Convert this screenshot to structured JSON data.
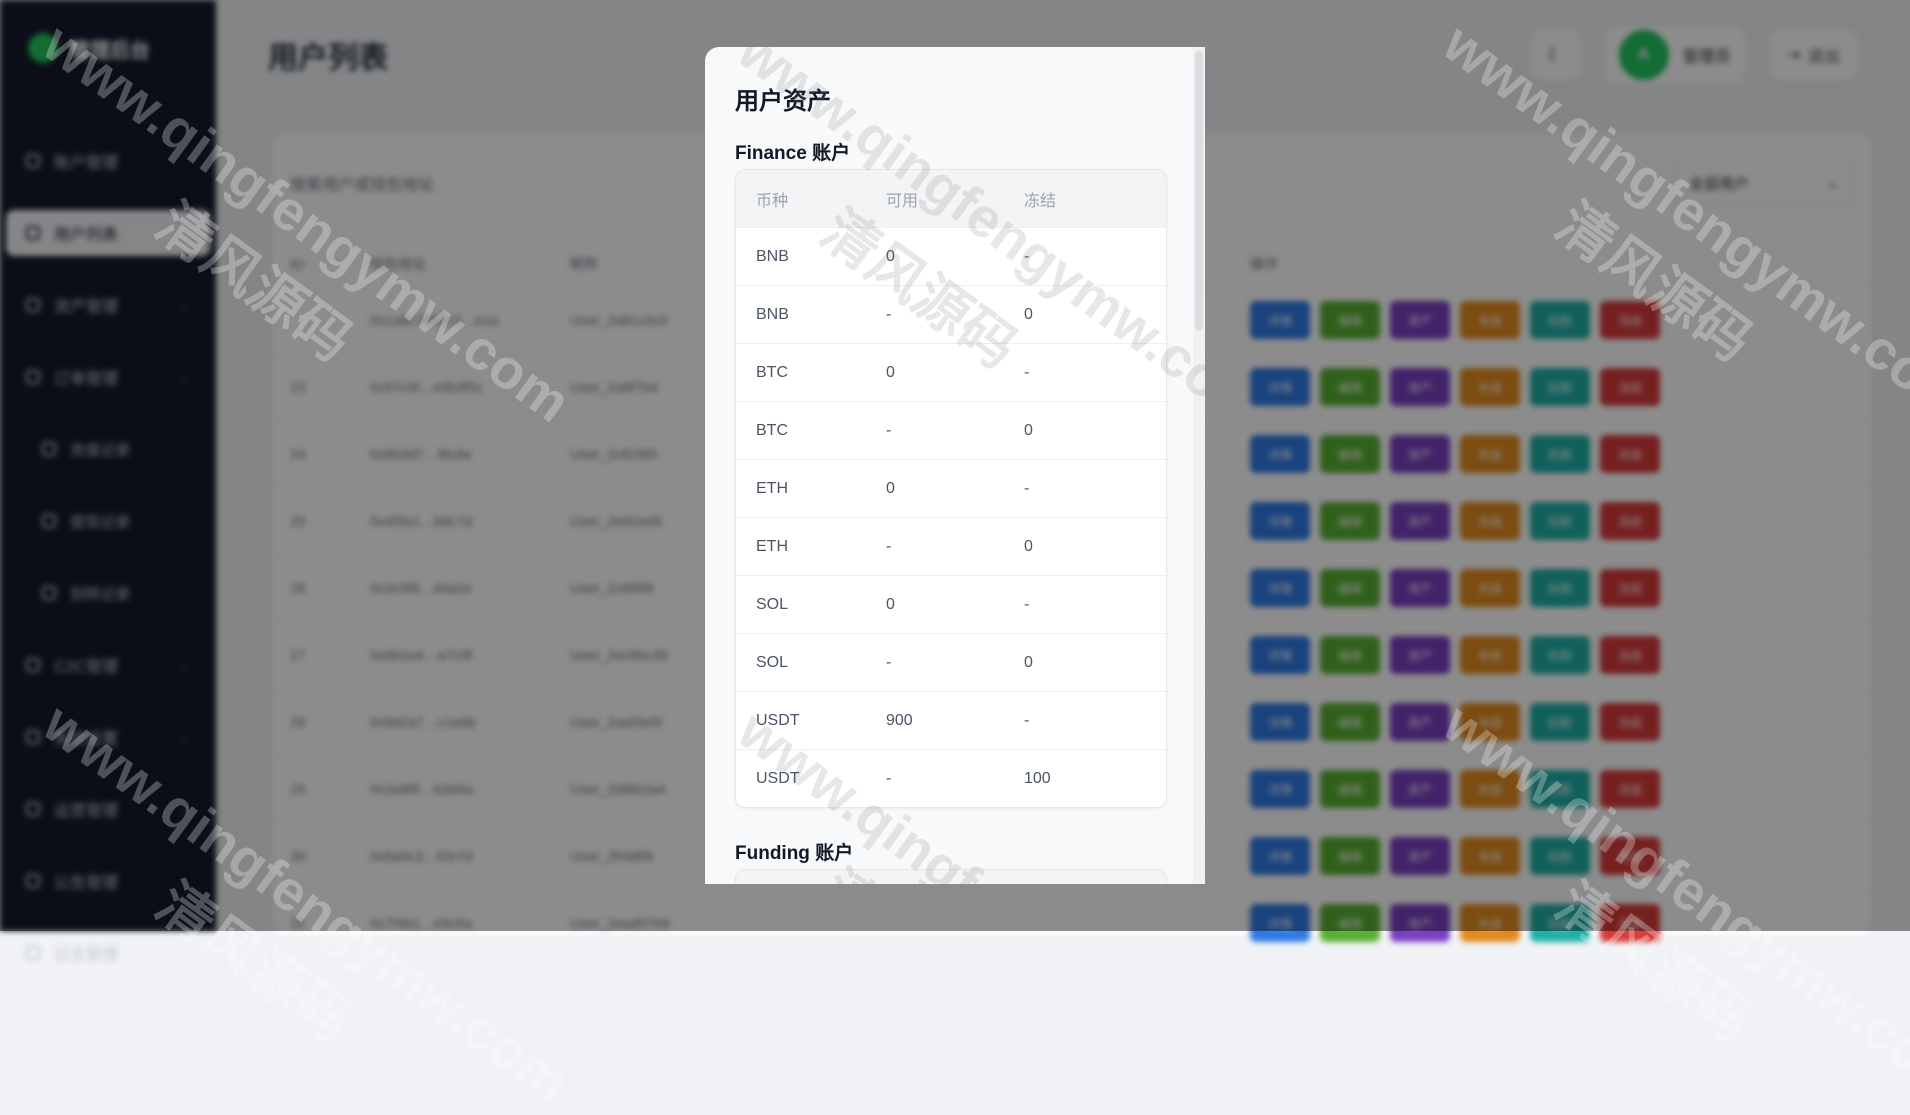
{
  "app": {
    "brand": "管理后台",
    "page_title": "用户列表",
    "user_avatar_text": "A",
    "username": "管理员",
    "logout_label": "退出"
  },
  "sidebar": {
    "items": [
      {
        "label": "账户管理",
        "caret": ""
      },
      {
        "label": "用户列表",
        "caret": ""
      },
      {
        "label": "资产管理",
        "caret": "⌄"
      },
      {
        "label": "订单管理",
        "caret": "⌄"
      },
      {
        "label": "充值记录",
        "caret": ""
      },
      {
        "label": "提现记录",
        "caret": ""
      },
      {
        "label": "划转记录",
        "caret": ""
      },
      {
        "label": "C2C管理",
        "caret": "⌄"
      },
      {
        "label": "系统设置",
        "caret": "⌄"
      },
      {
        "label": "运营管理",
        "caret": "⌄"
      },
      {
        "label": "公告管理",
        "caret": ""
      },
      {
        "label": "日志管理",
        "caret": ""
      }
    ]
  },
  "list": {
    "search_hint": "搜索用户或钱包地址",
    "filter_value": "全部用户",
    "headers": {
      "id": "ID",
      "addr": "钱包地址",
      "name": "昵称",
      "ops": "操作"
    },
    "rows": [
      {
        "id": "",
        "addr": "0x1a6c7f9f2c3…e1a",
        "name": "User_2a81c0c0"
      },
      {
        "id": "23",
        "addr": "0x97c5f…e9b3f5c",
        "name": "User_2a8f7b4"
      },
      {
        "id": "24",
        "addr": "0x8b3d7…f6c8e",
        "name": "User_2c81f80"
      },
      {
        "id": "25",
        "addr": "0x4f3e1…b8c7d",
        "name": "User_2e82a48"
      },
      {
        "id": "26",
        "addr": "0x3c5f9…d4a2e",
        "name": "User_2c8f9f8"
      },
      {
        "id": "27",
        "addr": "0x6b1e4…a7c9f",
        "name": "User_2ec8bc39"
      },
      {
        "id": "28",
        "addr": "0x9d2a7…c1e8b",
        "name": "User_2aaf3e5f"
      },
      {
        "id": "29",
        "addr": "0x2e8f6…b3d4a",
        "name": "User_2d9fe2a4"
      },
      {
        "id": "30",
        "addr": "0x5a9c3…f2e7d",
        "name": "User_2fcb8f9"
      },
      {
        "id": "31",
        "addr": "0x7f4b1…e9c6a",
        "name": "User_2ead97b6"
      }
    ],
    "op_buttons": [
      {
        "label": "详情",
        "color": "#2f7ae5"
      },
      {
        "label": "编辑",
        "color": "#58b032"
      },
      {
        "label": "资产",
        "color": "#7a3fc2"
      },
      {
        "label": "充值",
        "color": "#e38a1e"
      },
      {
        "label": "扣款",
        "color": "#1fb0a7"
      },
      {
        "label": "冻结",
        "color": "#d73a3a"
      }
    ]
  },
  "modal": {
    "title": "用户资产",
    "headers": {
      "currency": "币种",
      "available": "可用",
      "frozen": "冻结"
    },
    "finance": {
      "title": "Finance 账户",
      "rows": [
        {
          "currency": "BNB",
          "available": "0",
          "frozen": "-"
        },
        {
          "currency": "BNB",
          "available": "-",
          "frozen": "0"
        },
        {
          "currency": "BTC",
          "available": "0",
          "frozen": "-"
        },
        {
          "currency": "BTC",
          "available": "-",
          "frozen": "0"
        },
        {
          "currency": "ETH",
          "available": "0",
          "frozen": "-"
        },
        {
          "currency": "ETH",
          "available": "-",
          "frozen": "0"
        },
        {
          "currency": "SOL",
          "available": "0",
          "frozen": "-"
        },
        {
          "currency": "SOL",
          "available": "-",
          "frozen": "0"
        },
        {
          "currency": "USDT",
          "available": "900",
          "frozen": "-"
        },
        {
          "currency": "USDT",
          "available": "-",
          "frozen": "100"
        }
      ]
    },
    "funding": {
      "title": "Funding 账户"
    }
  },
  "watermark": {
    "url": "www.qingfengymw.com",
    "cn": "清风源码"
  }
}
